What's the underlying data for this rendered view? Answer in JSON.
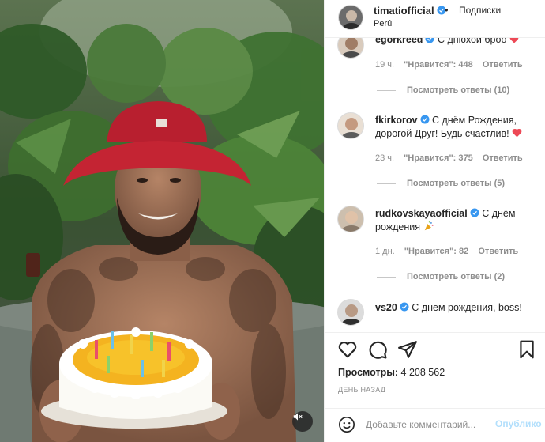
{
  "post": {
    "username": "timatiofficial",
    "separator": "•",
    "follow_label": "Подписки",
    "location": "Perú",
    "views_label": "Просмотры:",
    "views_count": "4 208 562",
    "time_ago": "ДЕНЬ НАЗАД"
  },
  "comments": [
    {
      "username": "egorkreed",
      "text": "С днюхой броо",
      "emoji": "heart",
      "age": "19 ч.",
      "likes": "\"Нравится\": 448",
      "reply": "Ответить",
      "view_replies": "Посмотреть ответы (10)"
    },
    {
      "username": "fkirkorov",
      "text": "С днём Рождения, дорогой Друг! Будь счастлив!",
      "emoji": "heart",
      "age": "23 ч.",
      "likes": "\"Нравится\": 375",
      "reply": "Ответить",
      "view_replies": "Посмотреть ответы (5)"
    },
    {
      "username": "rudkovskayaofficial",
      "text": "С днём рождения",
      "emoji": "party-popper",
      "age": "1 дн.",
      "likes": "\"Нравится\": 82",
      "reply": "Ответить",
      "view_replies": "Посмотреть ответы (2)"
    },
    {
      "username": "vs20",
      "text": "С днем рождения, boss!"
    }
  ],
  "composer": {
    "placeholder": "Добавьте комментарий...",
    "publish_label": "Опублико"
  },
  "icons": {
    "like": "heart-outline-icon",
    "comment": "comment-icon",
    "share": "paper-plane-icon",
    "save": "bookmark-icon",
    "emoji": "smiley-icon",
    "mute": "speaker-muted-icon",
    "verified": "verified-badge-icon"
  },
  "colors": {
    "verified": "#3897f0",
    "heart": "#ed4956",
    "meta_text": "#8e8e8e",
    "publish_disabled": "#b2dffc",
    "border": "#efefef"
  }
}
